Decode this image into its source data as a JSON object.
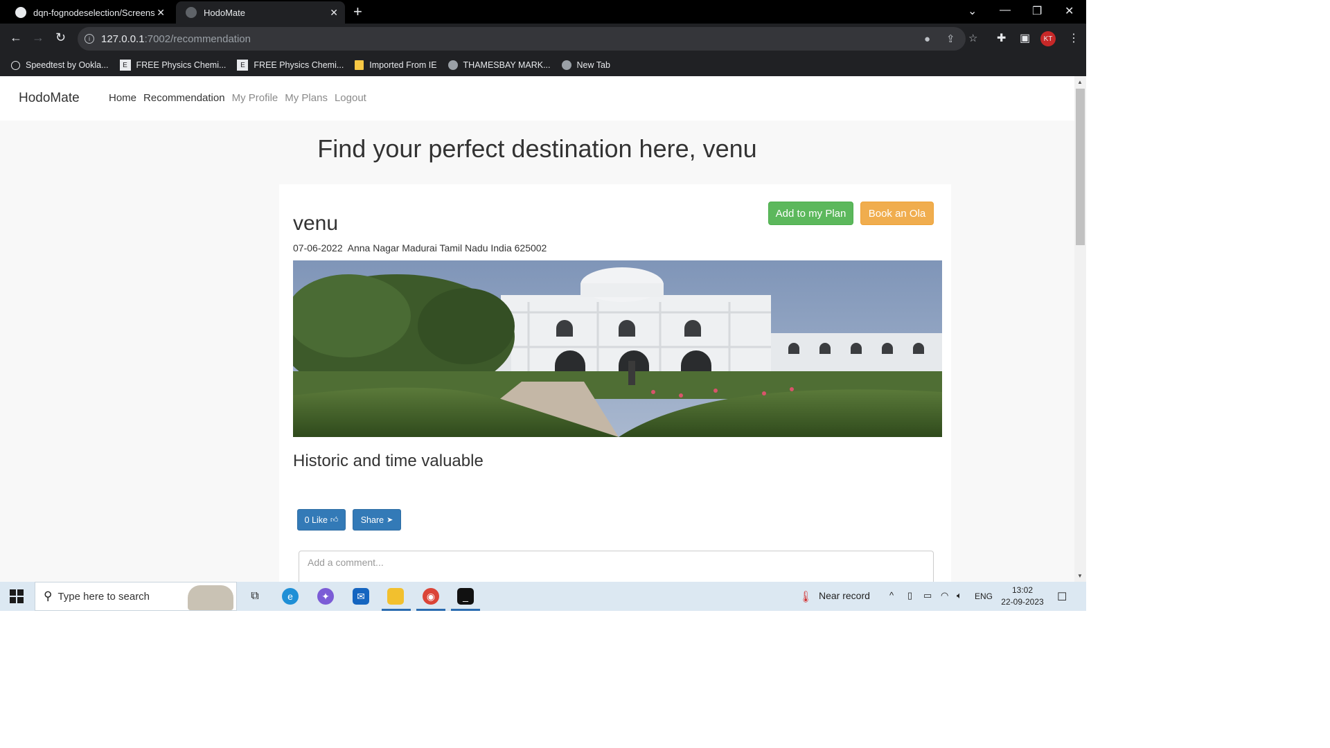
{
  "browser": {
    "tabs": [
      {
        "title": "dqn-fognodeselection/Screensho",
        "active": false
      },
      {
        "title": "HodoMate",
        "active": true
      }
    ],
    "url_host": "127.0.0.1",
    "url_path": ":7002/recommendation",
    "bookmarks": [
      {
        "label": "Speedtest by Ookla..."
      },
      {
        "label": "FREE Physics Chemi..."
      },
      {
        "label": "FREE Physics Chemi..."
      },
      {
        "label": "Imported From IE"
      },
      {
        "label": "THAMESBAY MARK..."
      },
      {
        "label": "New Tab"
      }
    ]
  },
  "navbar": {
    "brand": "HodoMate",
    "links": [
      {
        "label": "Home",
        "color": "#333333"
      },
      {
        "label": "Recommendation",
        "color": "#333333"
      },
      {
        "label": "My Profile",
        "color": "#8a8a8a"
      },
      {
        "label": "My Plans",
        "color": "#8a8a8a"
      },
      {
        "label": "Logout",
        "color": "#8a8a8a"
      }
    ]
  },
  "page": {
    "heading": "Find your perfect destination here, venu"
  },
  "card": {
    "title": "venu",
    "date": "07-06-2022",
    "address": "Anna Nagar Madurai Tamil Nadu India 625002",
    "add_plan_label": "Add to my Plan",
    "book_ola_label": "Book an Ola",
    "description": "Historic and time valuable",
    "like_label": "0 Like",
    "share_label": "Share",
    "comment_placeholder": "Add a comment..."
  },
  "colors": {
    "success": "#5cb85c",
    "warning": "#f0ad4e",
    "primary": "#337ab7"
  },
  "taskbar": {
    "search_placeholder": "Type here to search",
    "weather_text": "Near record",
    "language": "ENG",
    "time": "13:02",
    "date": "22-09-2023"
  }
}
